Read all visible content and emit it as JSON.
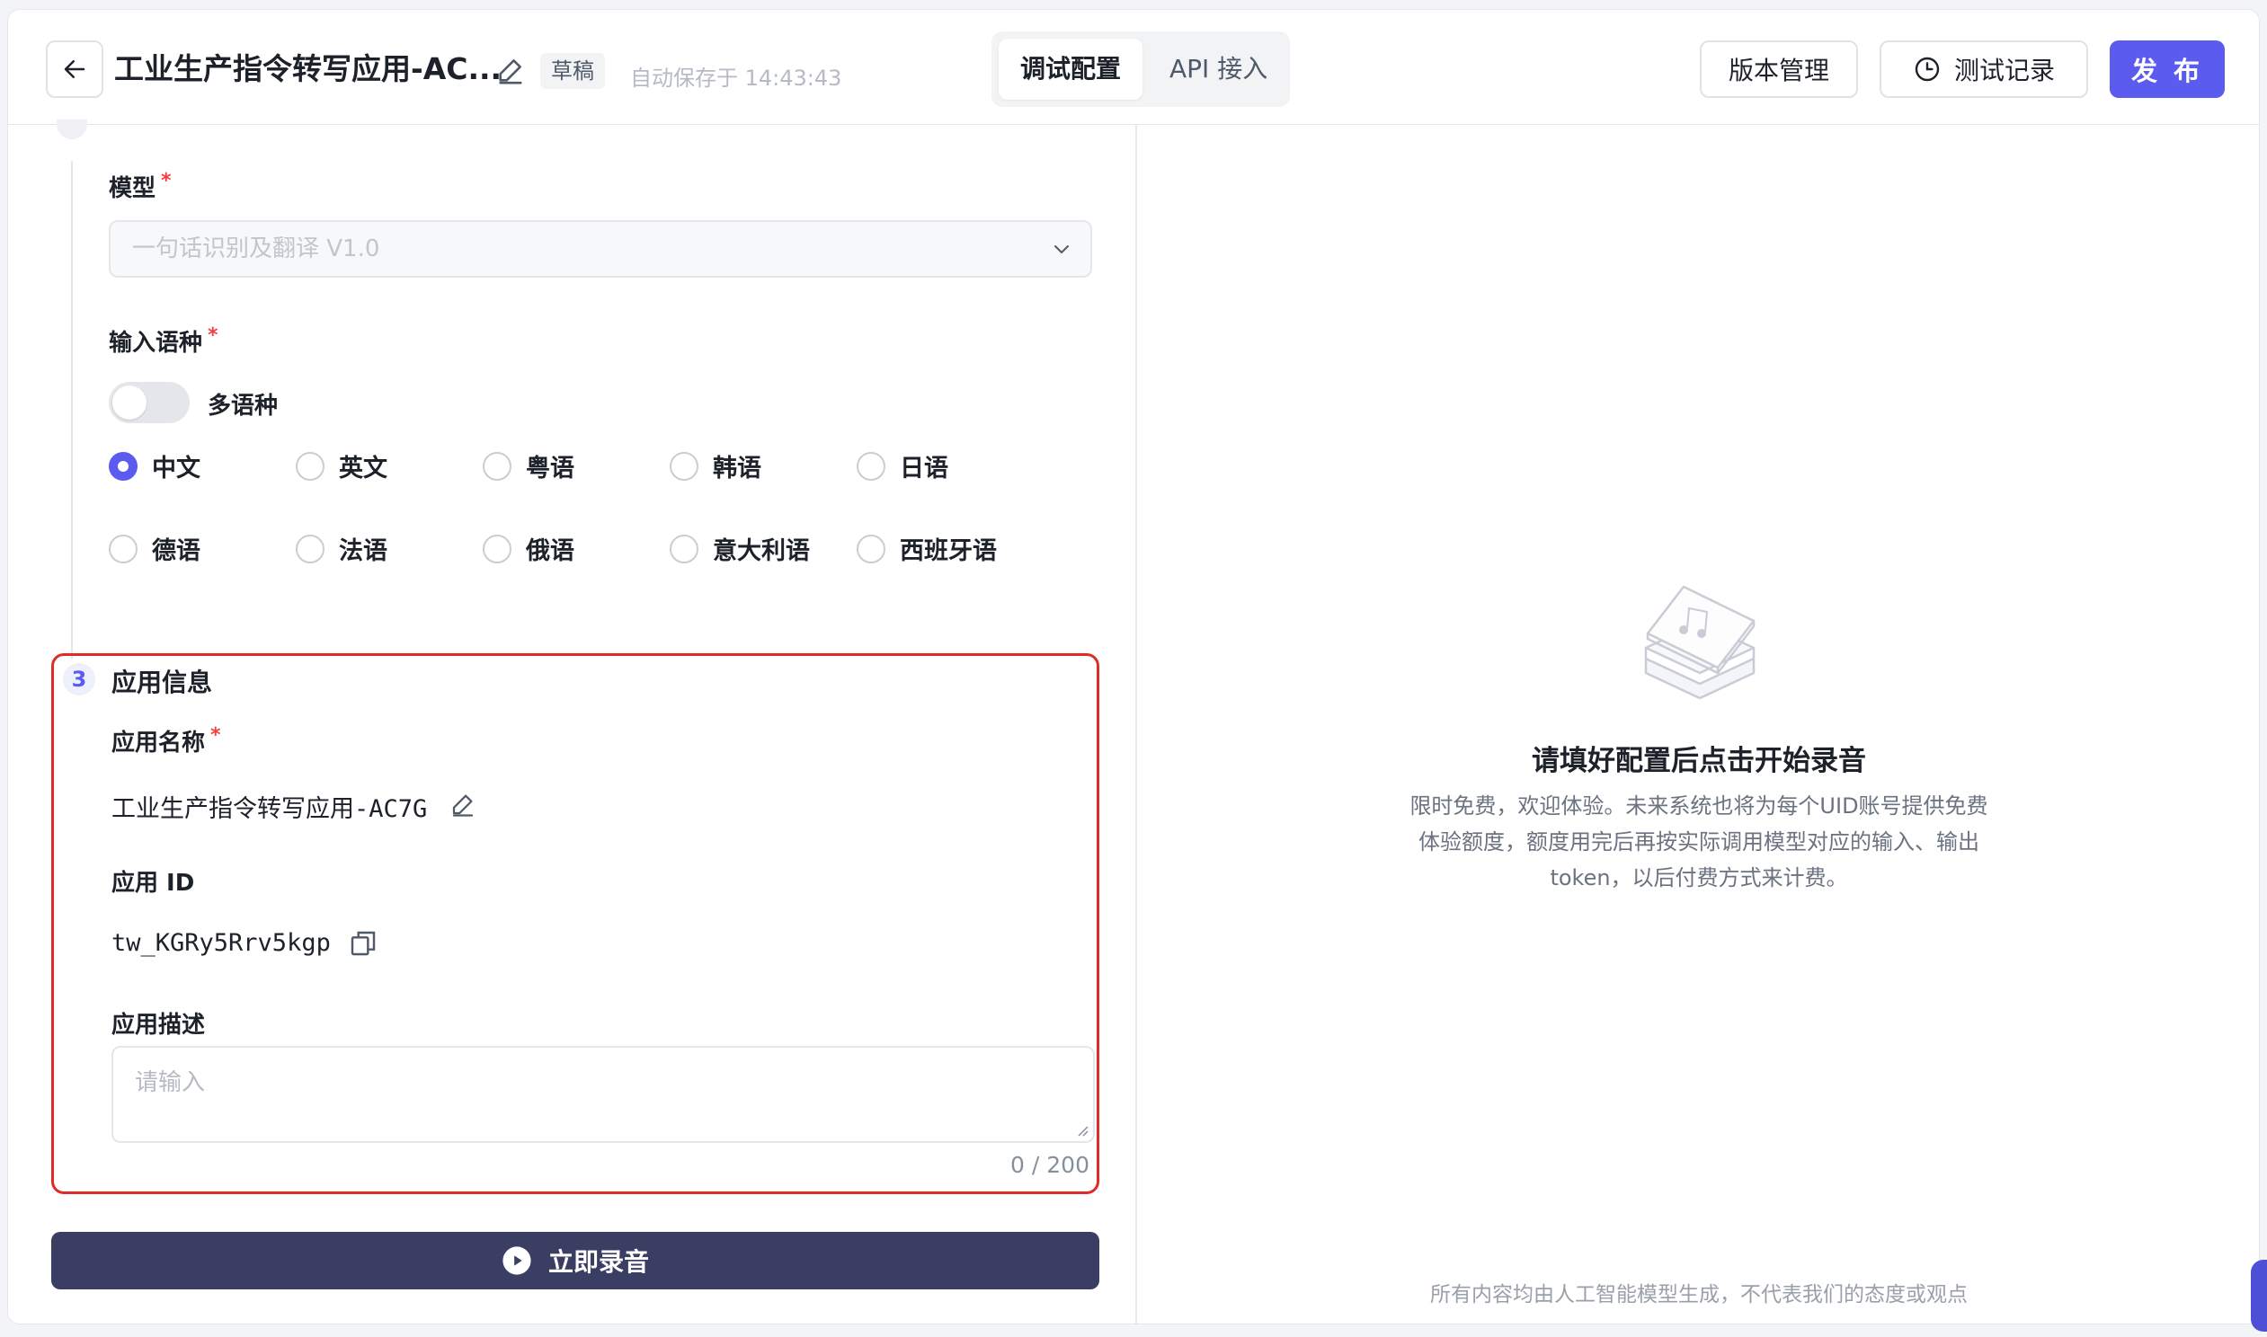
{
  "header": {
    "app_title": "工业生产指令转写应用-AC...",
    "draft_badge": "草稿",
    "autosave": "自动保存于 14:43:43",
    "tabs": [
      {
        "label": "调试配置",
        "active": true
      },
      {
        "label": "API 接入",
        "active": false
      }
    ],
    "version_btn": "版本管理",
    "tests_btn": "测试记录",
    "publish_btn": "发 布"
  },
  "config": {
    "model_label": "模型",
    "model_value": "一句话识别及翻译 V1.0",
    "lang_label": "输入语种",
    "multi_lang_label": "多语种",
    "multi_lang_on": false,
    "languages": [
      {
        "label": "中文",
        "checked": true
      },
      {
        "label": "英文",
        "checked": false
      },
      {
        "label": "粤语",
        "checked": false
      },
      {
        "label": "韩语",
        "checked": false
      },
      {
        "label": "日语",
        "checked": false
      },
      {
        "label": "德语",
        "checked": false
      },
      {
        "label": "法语",
        "checked": false
      },
      {
        "label": "俄语",
        "checked": false
      },
      {
        "label": "意大利语",
        "checked": false
      },
      {
        "label": "西班牙语",
        "checked": false
      }
    ],
    "required_mark": "*"
  },
  "app_info": {
    "step_number": "3",
    "section_title": "应用信息",
    "name_label": "应用名称",
    "name_value": "工业生产指令转写应用-AC7G",
    "id_label": "应用 ID",
    "id_value": "tw_KGRy5Rrv5kgp",
    "desc_label": "应用描述",
    "desc_placeholder": "请输入",
    "desc_counter": "0 / 200"
  },
  "record_btn": "立即录音",
  "right": {
    "empty_title": "请填好配置后点击开始录音",
    "empty_desc": "限时免费，欢迎体验。未来系统也将为每个UID账号提供免费体验额度，额度用完后再按实际调用模型对应的输入、输出token，以后付费方式来计费。",
    "footer_note": "所有内容均由人工智能模型生成，不代表我们的态度或观点"
  },
  "colors": {
    "accent": "#5b5bf0",
    "record_btn_bg": "#3b3e63",
    "highlight_border": "#e02b2b",
    "required": "#f53f3f"
  },
  "icons": [
    "arrow-left-icon",
    "pencil-icon",
    "clock-icon",
    "chevron-down-icon",
    "copy-icon",
    "play-circle-icon",
    "music-file-icon"
  ]
}
